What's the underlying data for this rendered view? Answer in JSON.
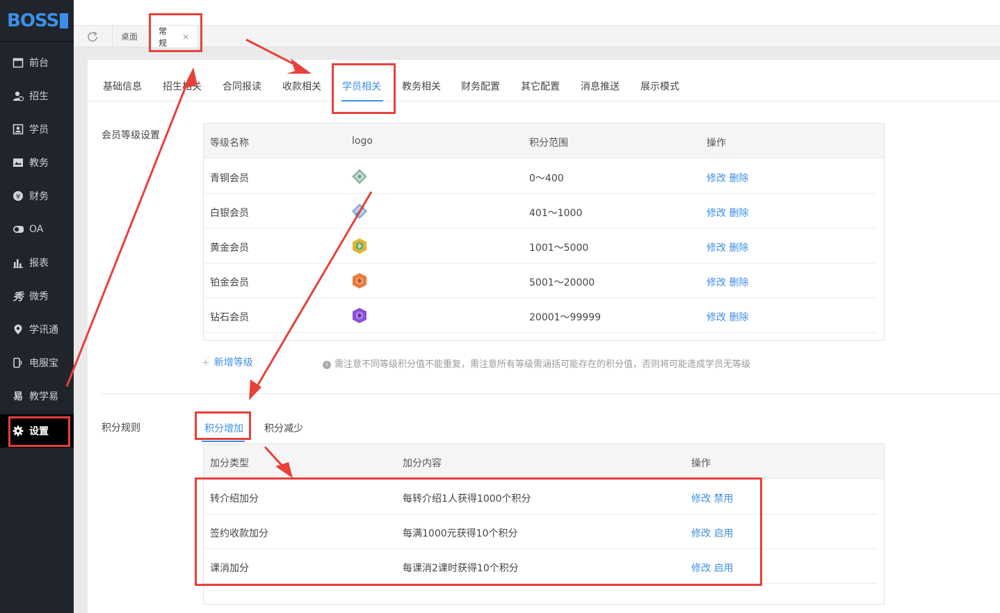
{
  "app": {
    "logo": "BOSS"
  },
  "sidebar": {
    "items": [
      {
        "label": "前台",
        "icon": "calendar-icon"
      },
      {
        "label": "招生",
        "icon": "user-add-icon"
      },
      {
        "label": "学员",
        "icon": "id-card-icon"
      },
      {
        "label": "教务",
        "icon": "book-icon"
      },
      {
        "label": "财务",
        "icon": "yen-icon"
      },
      {
        "label": "OA",
        "icon": "toggle-icon"
      },
      {
        "label": "报表",
        "icon": "bar-chart-icon"
      },
      {
        "label": "微秀",
        "icon": "xiu-icon"
      },
      {
        "label": "学讯通",
        "icon": "location-pin-icon"
      },
      {
        "label": "电服宝",
        "icon": "phone-icon"
      },
      {
        "label": "教学易",
        "icon": "jiao-icon"
      },
      {
        "label": "设置",
        "icon": "gear-icon"
      }
    ]
  },
  "tabs": [
    {
      "label": "桌面"
    },
    {
      "label": "常规",
      "close": "×"
    }
  ],
  "subnav": {
    "items": [
      {
        "label": "基础信息"
      },
      {
        "label": "招生相关"
      },
      {
        "label": "合同报读"
      },
      {
        "label": "收款相关"
      },
      {
        "label": "学员相关"
      },
      {
        "label": "教务相关"
      },
      {
        "label": "财务配置"
      },
      {
        "label": "其它配置"
      },
      {
        "label": "消息推送"
      },
      {
        "label": "展示模式"
      }
    ]
  },
  "member_levels": {
    "section_label": "会员等级设置",
    "columns": [
      "等级名称",
      "logo",
      "积分范围",
      "操作"
    ],
    "rows": [
      {
        "name": "青铜会员",
        "range": "0～400",
        "edit": "修改",
        "delete": "删除",
        "gem": "bronze-gem-icon"
      },
      {
        "name": "白银会员",
        "range": "401～1000",
        "edit": "修改",
        "delete": "删除",
        "gem": "silver-gem-icon"
      },
      {
        "name": "黄金会员",
        "range": "1001～5000",
        "edit": "修改",
        "delete": "删除",
        "gem": "gold-gem-icon"
      },
      {
        "name": "铂金会员",
        "range": "5001～20000",
        "edit": "修改",
        "delete": "删除",
        "gem": "platinum-gem-icon"
      },
      {
        "name": "钻石会员",
        "range": "20001～99999",
        "edit": "修改",
        "delete": "删除",
        "gem": "diamond-gem-icon"
      }
    ],
    "add_label": "新增等级",
    "hint": "需注意不同等级积分值不能重复，需注意所有等级需涵括可能存在的积分值，否则将可能造成学员无等级"
  },
  "points_rules": {
    "section_label": "积分规则",
    "tabs": [
      "积分增加",
      "积分减少"
    ],
    "columns": [
      "加分类型",
      "加分内容",
      "操作"
    ],
    "rows": [
      {
        "type": "转介绍加分",
        "content": "每转介绍1人获得1000个积分",
        "edit": "修改",
        "toggle": "禁用"
      },
      {
        "type": "签约收款加分",
        "content": "每满1000元获得10个积分",
        "edit": "修改",
        "toggle": "启用"
      },
      {
        "type": "课消加分",
        "content": "每课消2课时获得10个积分",
        "edit": "修改",
        "toggle": "启用"
      }
    ]
  },
  "colors": {
    "accent": "#3c8fe6",
    "sidebar_bg": "#20242b",
    "annotation": "#e8403a"
  }
}
